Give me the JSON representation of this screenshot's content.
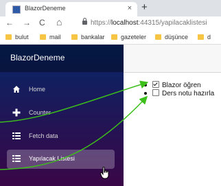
{
  "browser": {
    "tab_title": "BlazorDeneme",
    "tab_close": "×",
    "new_tab": "+",
    "nav_back": "←",
    "nav_forward": "→",
    "nav_reload": "C",
    "nav_home": "⌂",
    "url_prefix": "https://",
    "url_host": "localhost",
    "url_rest": ":44315/yapilacaklistesi",
    "bookmarks": [
      "bulut",
      "mail",
      "bankalar",
      "gazeteler",
      "düşünce",
      "d"
    ]
  },
  "app": {
    "brand": "BlazorDeneme",
    "nav": [
      {
        "label": "Home",
        "icon": "home-icon"
      },
      {
        "label": "Counter",
        "icon": "plus-icon"
      },
      {
        "label": "Fetch data",
        "icon": "list-icon"
      },
      {
        "label": "Yapılacak Listesi",
        "icon": "list-icon",
        "active": true
      }
    ],
    "todos": [
      {
        "text": "Blazor öğren",
        "done": true
      },
      {
        "text": "Ders notu hazırla",
        "done": false
      }
    ]
  },
  "colors": {
    "sidebar_top": "#052767",
    "sidebar_bottom": "#3a0647",
    "annotation": "#3cbf1a"
  }
}
